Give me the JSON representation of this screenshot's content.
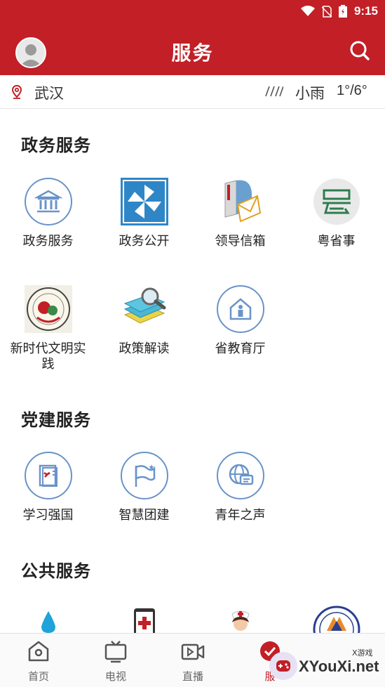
{
  "status_bar": {
    "time": "9:15"
  },
  "header": {
    "title": "服务"
  },
  "weather": {
    "city": "武汉",
    "condition": "小雨",
    "temperature": "1°/6°"
  },
  "sections": [
    {
      "title": "政务服务",
      "items": [
        {
          "label": "政务服务",
          "icon": "government-building-icon"
        },
        {
          "label": "政务公开",
          "icon": "pinwheel-icon"
        },
        {
          "label": "领导信箱",
          "icon": "mailbox-icon"
        },
        {
          "label": "粤省事",
          "icon": "yue-app-icon"
        },
        {
          "label": "新时代文明实践",
          "icon": "civilization-seal-icon"
        },
        {
          "label": "政策解读",
          "icon": "books-magnifier-icon"
        },
        {
          "label": "省教育厅",
          "icon": "education-house-icon"
        }
      ]
    },
    {
      "title": "党建服务",
      "items": [
        {
          "label": "学习强国",
          "icon": "party-book-icon"
        },
        {
          "label": "智慧团建",
          "icon": "flag-icon"
        },
        {
          "label": "青年之声",
          "icon": "globe-chat-icon"
        }
      ]
    },
    {
      "title": "公共服务",
      "items": [
        {
          "label": "",
          "icon": "water-drop-icon"
        },
        {
          "label": "",
          "icon": "phone-medical-icon"
        },
        {
          "label": "",
          "icon": "nurse-icon"
        },
        {
          "label": "",
          "icon": "organization-seal-icon"
        }
      ]
    }
  ],
  "bottom_nav": [
    {
      "label": "首页",
      "icon": "home-icon"
    },
    {
      "label": "电视",
      "icon": "tv-icon"
    },
    {
      "label": "直播",
      "icon": "live-video-icon"
    },
    {
      "label": "服",
      "icon": "service-icon"
    }
  ],
  "watermark": {
    "text": "XYouXi.net",
    "small": "X游戏"
  },
  "colors": {
    "brand_red": "#c21f26",
    "icon_blue": "#6a93c9"
  }
}
